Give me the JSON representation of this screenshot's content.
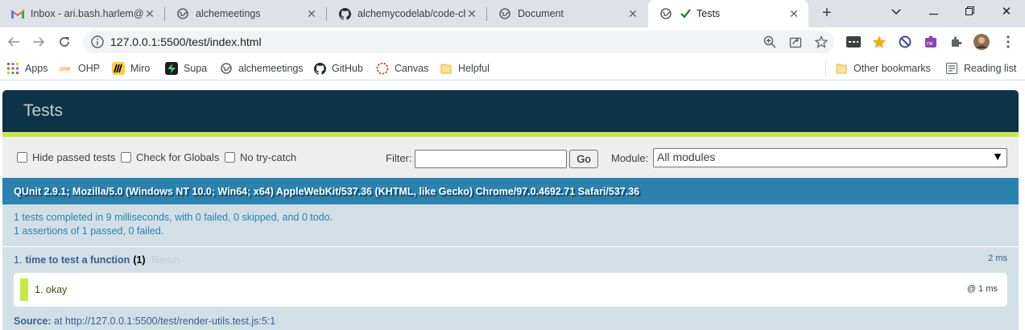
{
  "browser": {
    "tabs": [
      {
        "title": "Inbox - ari.bash.harlem@gmail.com",
        "icon": "gmail-icon",
        "active": false
      },
      {
        "title": "alchemeetings",
        "icon": "globe-icon",
        "active": false
      },
      {
        "title": "alchemycodelab/code-challenges",
        "icon": "github-icon",
        "active": false
      },
      {
        "title": "Document",
        "icon": "globe-icon",
        "active": false
      },
      {
        "title": "Tests",
        "icon": "globe-icon",
        "active": true
      }
    ],
    "url": "127.0.0.1:5500/test/index.html",
    "bookmarks": [
      {
        "label": "Apps",
        "icon": "apps-grid-icon"
      },
      {
        "label": "OHP",
        "icon": "one-icon"
      },
      {
        "label": "Miro",
        "icon": "miro-icon"
      },
      {
        "label": "Supa",
        "icon": "supabase-icon"
      },
      {
        "label": "alchemeetings",
        "icon": "globe-icon"
      },
      {
        "label": "GitHub",
        "icon": "github-icon"
      },
      {
        "label": "Canvas",
        "icon": "canvas-icon"
      },
      {
        "label": "Helpful",
        "icon": "folder-icon"
      }
    ],
    "other_bookmarks": "Other bookmarks",
    "reading_list": "Reading list"
  },
  "qunit": {
    "title": "Tests",
    "toolbar": {
      "hide_passed": "Hide passed tests",
      "check_globals": "Check for Globals",
      "no_try_catch": "No try-catch",
      "filter_label": "Filter:",
      "filter_value": "",
      "go_label": "Go",
      "module_label": "Module:",
      "module_selected": "All modules"
    },
    "useragent": "QUnit 2.9.1; Mozilla/5.0 (Windows NT 10.0; Win64; x64) AppleWebKit/537.36 (KHTML, like Gecko) Chrome/97.0.4692.71 Safari/537.36",
    "result_line1": "1 tests completed in 9 milliseconds, with 0 failed, 0 skipped, and 0 todo.",
    "result_line2": "1 assertions of 1 passed, 0 failed.",
    "test": {
      "number": "1.",
      "name": "time to test a function",
      "count": "(1)",
      "rerun": "Rerun",
      "runtime": "2 ms",
      "assertion": "1. okay",
      "assertion_time": "@ 1 ms",
      "source_label": "Source:",
      "source_value": "at http://127.0.0.1:5500/test/render-utils.test.js:5:1"
    }
  },
  "colors": {
    "qunit_header": "#0d3349",
    "qunit_banner_pass": "#c6e746",
    "qunit_useragent": "#2b81af",
    "qunit_result_bg": "#d2e0e6"
  }
}
